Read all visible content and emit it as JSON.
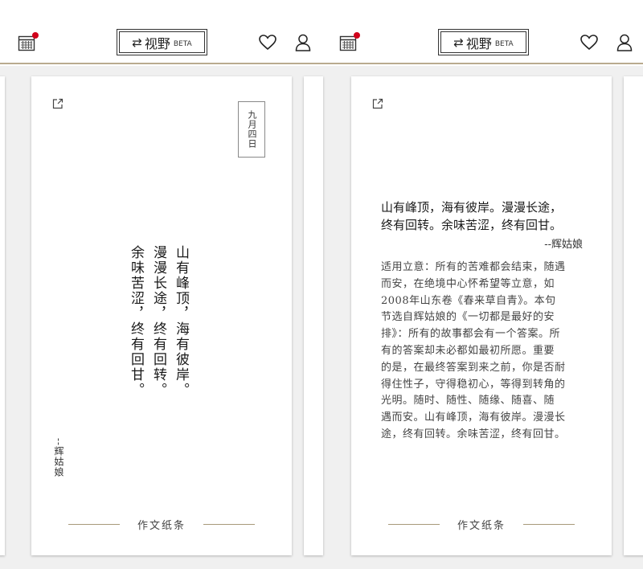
{
  "colors": {
    "accent_line": "#b9ab8f",
    "notification_dot": "#d0021b",
    "stage_bg": "#f0f0f0"
  },
  "icons": {
    "calendar": "calendar-icon",
    "heart": "heart-icon",
    "user": "user-icon",
    "share": "share-icon",
    "swap": "swap-icon"
  },
  "header": {
    "swap_glyph": "⇄",
    "view_label": "视野",
    "beta_label": "BETA"
  },
  "card_left": {
    "date": "九月四日",
    "poem_lines": [
      "山有峰顶，海有彼岸。",
      "漫漫长途，终有回转。",
      "余味苦涩，终有回甘。"
    ],
    "author": "--辉姑娘",
    "footer": "作文纸条"
  },
  "card_right": {
    "poem_lines": [
      "山有峰顶，海有彼岸。漫漫长途，",
      "终有回转。余味苦涩，终有回甘。"
    ],
    "author": "--辉姑娘",
    "note_lines": [
      "适用立意：所有的苦难都会结束，随遇",
      "而安，在绝境中心怀希望等立意，如",
      "2008年山东卷《春来草自青》。本句",
      "节选自辉姑娘的《一切都是最好的安",
      "排》：所有的故事都会有一个答案。所",
      "有的答案却未必都如最初所愿。重要",
      "的是，在最终答案到来之前，你是否耐",
      "得住性子，守得稳初心，等得到转角的",
      "光明。随时、随性、随缘、随喜、随",
      "遇而安。山有峰顶，海有彼岸。漫漫长",
      "途，终有回转。余味苦涩，终有回甘。"
    ],
    "footer": "作文纸条"
  }
}
